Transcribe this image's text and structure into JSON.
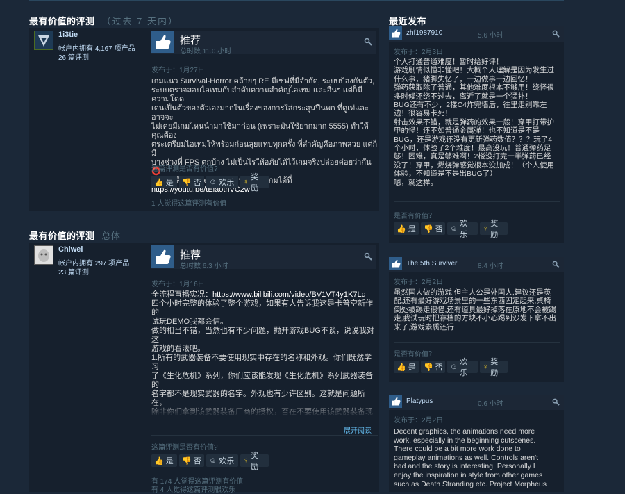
{
  "sections": {
    "most_helpful_recent": {
      "title": "最有价值的评测",
      "subtitle": "（过去 7 天内）"
    },
    "most_helpful_overall": {
      "title": "最有价值的评测",
      "subtitle": "总体"
    },
    "recent": {
      "title": "最近发布"
    }
  },
  "reviews_left": [
    {
      "author": "1i3tie",
      "products": "帐户内拥有 4,167 项产品",
      "reviews": "26 篇评测",
      "rec": "推荐",
      "hours": "总时数 11.0 小时",
      "posted": "发布于：1月27日",
      "text": "เกมแนว Survival-Horror คล้ายๆ RE มีเซฟที่มีจำกัด, ระบบป้องกันตัว,\nระบบตรวจสอบไอเทมกับสำดับความสำคัญไอเทม และอื่นๆ แต่ก็มีความโดด\nเด่นเป็นตัวของตัวเองมากในเรื่องของการใส่กระสุนปืนพก ที่ดูเท่และอาจจะ\nไม่เคยมีเกมไหนนำมาใช้มาก่อน (เพราะมันใช้ยากมาก 5555) ทำให้คุณต้อง\nตระเตรียมไอเทมให้พร้อมก่อนลุยแทบทุกครั้ง ที่สำคัญคือภาพสวย แต่ก็มี\nบางช่วงที่ FPS ตกบ้าง ไม่เป็นไรให้อภัยได้ไว้เกมจริงปล่อยค่อยว่ากัน ⭕\nรับชมคลิป Gameplay แนะนำระบบเกมได้ที่",
      "link": "https://youtu.be/tElaotnVC2w",
      "helpful_q": "这篇评测是否有价值?",
      "buttons": [
        "是",
        "否",
        "欢乐",
        "奖励"
      ],
      "helpful_count": "1 人觉得这篇评测有价值"
    },
    {
      "author": "Chiwei",
      "products": "帐户内拥有 297 项产品",
      "reviews": "23 篇评测",
      "rec": "推荐",
      "hours": "总时数 6.3 小时",
      "posted": "发布于：1月16日",
      "text_prefix": "全流程直播实况：",
      "link": "https://www.bilibili.com/video/BV1VT4y1K7Lq",
      "text": "四个小时完整的体验了整个游戏，如果有人告诉我这是卡普空新作的\n试玩DEMO我都会信。\n做的相当不错，当然也有不少问题，抛开游戏BUG不谈，说说我对这\n游戏的看法吧。\n1.所有的武器装备不要使用现实中存在的名称和外观。你们既然学习\n了《生化危机》系列，你们应该能发现《生化危机》系列武器装备的\n名字都不是现实武器的名字。外观也有少许区别。这就是问题所在，\n除非你们拿到该武器装备厂商的授权，否在不要使用该武器装备现实\n的名字，并且要把武器装备上的文字全部替换或者删掉，在外形上做\n出少许不同。尽量避免法律问题。\n2.三种难度的差异过大，简单难度不仅有包更大弹药补给更多敌人也\n相对较弱。而普通则突然难度大增，我在首次尝试普通难度时尽量慢\n慢，但是在做意到一修的时候已经弹尽粮绝，无法继续进行游戏，而",
      "readmore": "展开阅读",
      "helpful_q": "这篇评测是否有价值?",
      "buttons": [
        "是",
        "否",
        "欢乐",
        "奖励"
      ],
      "helpful_count": "有 174 人觉得这篇评测有价值",
      "funny_count": "有 4 人觉得这篇评测很欢乐"
    }
  ],
  "reviews_right": [
    {
      "author": "zhf1987910",
      "hours": "5.6 小时",
      "posted": "发布于：2月3日",
      "text": "个人打通普通难度！暂时给好评！\n游戏剧情似懂非懂吧！大概个人理解是因为发生过\n什么事，猪脚失忆了，一边做事一边回忆！\n弹药获取除了普通，其他难度根本不够用！绕怪很\n多时候还绕不过去，离近了就是一个猛扑！\nBUG还有不少，2楼C4炸完墙后，往里走别靠左\n边！很容易卡死！\n射击效果不错，就是弹药的效果一般！穿甲打带护\n甲的怪！还不如普通金属弹！也不知道是不是\nBUG，还是游戏还没有更新弹药数值？？？玩了4\n个小时，体验了2个难度！最高没玩！普通弹药足\n够！困难，真是够难啊！2楼没打完一半弹药已经\n没了！穿甲，燃烧弹感觉根本没加成！（个人使用\n体验，不知道是不是出BUG了）\n嗯，就这样。",
      "helpful_q": "是否有价值？",
      "buttons": [
        "是",
        "否",
        "欢乐",
        "奖励"
      ]
    },
    {
      "author": "The 5th Surviver",
      "hours": "8.4 小时",
      "posted": "发布于：2月2日",
      "text": "虽然国人做的游戏,但主人公是外国人,建议还是英\n配,还有最好游戏场景里的一些东西固定起来,桌椅\n倒处被踢走很怪,还有道具最好掉落在原地不会被踢\n走,我试玩时把存档的方块不小心踢到沙发下拿不出\n来了,游戏素质还行",
      "helpful_q": "是否有价值？",
      "buttons": [
        "是",
        "否",
        "欢乐",
        "奖励"
      ]
    },
    {
      "author": "Platypus",
      "hours": "0.6 小时",
      "posted": "发布于：2月2日",
      "text": "Decent graphics, the animations need more\nwork, especially in the beginning cutscenes.\nThere could be a bit more work done to\ngameplay animations as well. Controls aren't\nbad and the story is interesting. Personally I\nenjoy the inspiration in style from other games\nsuch as Death Stranding etc. Project Morpheus"
    }
  ]
}
